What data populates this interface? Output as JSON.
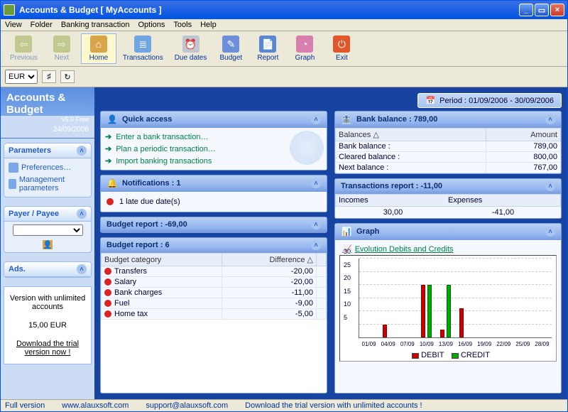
{
  "window": {
    "title": "Accounts & Budget [ MyAccounts ]"
  },
  "menus": [
    "View",
    "Folder",
    "Banking transaction",
    "Options",
    "Tools",
    "Help"
  ],
  "toolbar": [
    {
      "id": "previous",
      "label": "Previous",
      "color": "#8fa43c",
      "glyph": "⇦",
      "disabled": true
    },
    {
      "id": "next",
      "label": "Next",
      "color": "#8fa43c",
      "glyph": "⇨",
      "disabled": true
    },
    {
      "id": "home",
      "label": "Home",
      "color": "#d8a54b",
      "glyph": "⌂",
      "active": true
    },
    {
      "id": "transactions",
      "label": "Transactions",
      "color": "#6fa6e3",
      "glyph": "≣"
    },
    {
      "id": "duedates",
      "label": "Due dates",
      "color": "#bfc6d0",
      "glyph": "⏰"
    },
    {
      "id": "budget",
      "label": "Budget",
      "color": "#6b8fd8",
      "glyph": "✎"
    },
    {
      "id": "report",
      "label": "Report",
      "color": "#5c86cf",
      "glyph": "📄"
    },
    {
      "id": "graph",
      "label": "Graph",
      "color": "#d97fb0",
      "glyph": "◔"
    },
    {
      "id": "exit",
      "label": "Exit",
      "color": "#e0572c",
      "glyph": "⏻"
    }
  ],
  "currency_sel": "EUR",
  "sidebar": {
    "title": "Accounts & Budget",
    "version": "v5.0 Free",
    "date": "24/09/2006",
    "parameters_h": "Parameters",
    "param_links": [
      "Preferences…",
      "Management parameters"
    ],
    "payer_h": "Payer / Payee",
    "ads_h": "Ads.",
    "ads_text1": "Version with unlimited accounts",
    "ads_price": "15,00 EUR",
    "ads_link": "Download the trial version now !"
  },
  "period": {
    "label": "Period : 01/09/2006 - 30/09/2006"
  },
  "quick_access": {
    "title": "Quick access",
    "items": [
      "Enter a bank transaction…",
      "Plan a periodic transaction…",
      "Import banking transactions"
    ]
  },
  "notifications": {
    "title": "Notifications :  1",
    "row": "1 late due date(s)"
  },
  "budget_report_head": "Budget report : -69,00",
  "budget_report2": {
    "title": "Budget report : 6",
    "col1": "Budget category",
    "col2": "Difference",
    "rows": [
      {
        "name": "Transfers",
        "val": "-20,00"
      },
      {
        "name": "Salary",
        "val": "-20,00"
      },
      {
        "name": "Bank charges",
        "val": "-11,00"
      },
      {
        "name": "Fuel",
        "val": "-9,00"
      },
      {
        "name": "Home tax",
        "val": "-5,00"
      }
    ]
  },
  "bank_balance": {
    "title": "Bank balance :  789,00",
    "col1": "Balances",
    "col2": "Amount",
    "rows": [
      {
        "name": "Bank balance :",
        "val": "789,00"
      },
      {
        "name": "Cleared balance :",
        "val": "800,00"
      },
      {
        "name": "Next balance :",
        "val": "767,00"
      }
    ]
  },
  "trans_report": {
    "title": "Transactions report : -11,00",
    "incomes_l": "Incomes",
    "expenses_l": "Expenses",
    "incomes": "30,00",
    "expenses": "-41,00"
  },
  "graph": {
    "panel_title": "Graph",
    "title": "Evolution Debits and Credits",
    "legend_debit": "DEBIT",
    "legend_credit": "CREDIT"
  },
  "chart_data": {
    "type": "bar",
    "categories": [
      "01/09",
      "04/09",
      "07/09",
      "10/09",
      "13/09",
      "16/09",
      "19/09",
      "22/09",
      "25/09",
      "28/09"
    ],
    "series": [
      {
        "name": "DEBIT",
        "values": [
          0,
          5,
          0,
          20,
          3,
          11,
          0,
          0,
          0,
          0
        ]
      },
      {
        "name": "CREDIT",
        "values": [
          0,
          0,
          0,
          20,
          20,
          0,
          0,
          0,
          0,
          0
        ]
      }
    ],
    "ylim": [
      0,
      30
    ],
    "yticks": [
      5,
      10,
      15,
      20,
      25,
      30
    ]
  },
  "status": {
    "full": "Full version",
    "site": "www.alauxsoft.com",
    "mail": "support@alauxsoft.com",
    "trial": "Download the trial version with unlimited accounts !"
  }
}
